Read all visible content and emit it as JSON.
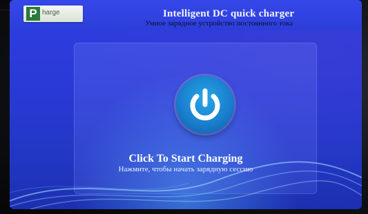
{
  "header": {
    "logo_letter": "P",
    "logo_text": "harge",
    "title": "Intelligent DC quick charger",
    "subtitle": "Умное зарядное устройство постоянного тока"
  },
  "main": {
    "power_button_icon": "power-icon",
    "cta_label": "Click To Start Charging",
    "cta_sublabel": "Нажмите, чтобы начать зарядную сессию"
  },
  "colors": {
    "screen_blue": "#2a3ad6",
    "button_blue": "#1a7fcf",
    "logo_green": "#2a7a3c"
  }
}
